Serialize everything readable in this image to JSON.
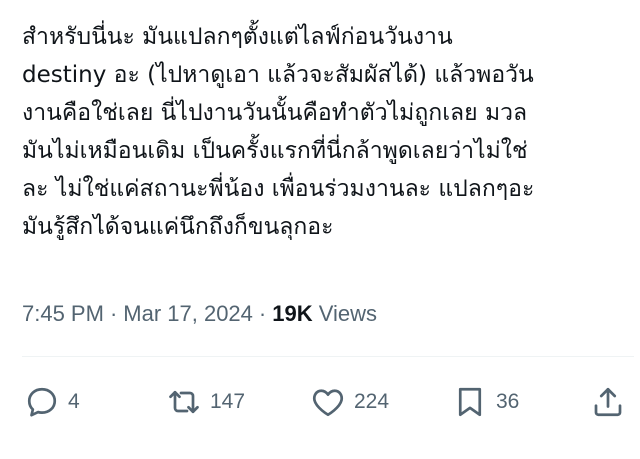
{
  "tweet": {
    "lines": [
      "สำหรับนี่นะ มันแปลกๆตั้งแต่ไลฟ์ก่อนวันงาน",
      "destiny อะ (ไปหาดูเอา แล้วจะสัมผัสได้) แล้วพอวัน",
      "งานคือใช่เลย นี่ไปงานวันนั้นคือทำตัวไม่ถูกเลย มวล",
      "มันไม่เหมือนเดิม เป็นครั้งแรกที่นี่กล้าพูดเลยว่าไม่ใช่",
      "ละ ไม่ใช่แค่สถานะพี่น้อง เพื่อนร่วมงานละ แปลกๆอะ",
      "มันรู้สึกได้จนแค่นึกถึงก็ขนลุกอะ"
    ]
  },
  "meta": {
    "time": "7:45 PM",
    "separator": "·",
    "date": "Mar 17, 2024",
    "views_count": "19K",
    "views_label": "Views"
  },
  "actions": {
    "reply": {
      "icon": "reply-icon",
      "count": "4"
    },
    "retweet": {
      "icon": "retweet-icon",
      "count": "147"
    },
    "like": {
      "icon": "heart-icon",
      "count": "224"
    },
    "bookmark": {
      "icon": "bookmark-icon",
      "count": "36"
    },
    "share": {
      "icon": "share-icon"
    }
  },
  "colors": {
    "text": "#0f1419",
    "secondary": "#536471",
    "divider": "#eff3f4"
  }
}
